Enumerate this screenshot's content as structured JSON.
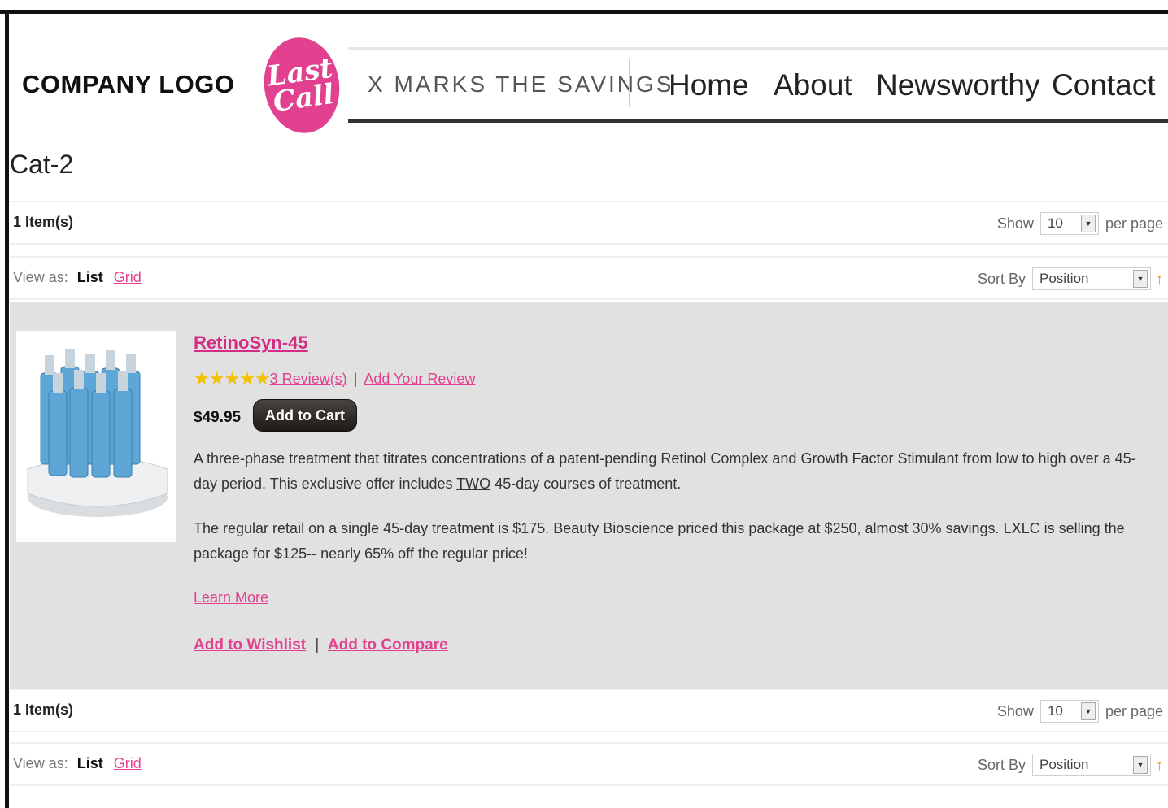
{
  "header": {
    "logo_text": "COMPANY LOGO",
    "badge_line1": "Last",
    "badge_line2": "Call",
    "tagline": "X MARKS THE SAVINGS",
    "nav": [
      "Home",
      "About",
      "Newsworthy",
      "Contact"
    ]
  },
  "page_title": "Cat-2",
  "toolbar": {
    "items_count": "1 Item(s)",
    "show_label": "Show",
    "show_value": "10",
    "per_page_label": "per page",
    "view_as_label": "View as:",
    "view_list": "List",
    "view_grid": "Grid",
    "sort_by_label": "Sort By",
    "sort_value": "Position",
    "sort_arrow": "↑"
  },
  "product": {
    "name": "RetinoSyn-45",
    "stars": "★★★★★",
    "rating_value": 5,
    "reviews_link": "3 Review(s)",
    "review_sep": "|",
    "add_review_link": "Add Your Review",
    "price": "$49.95",
    "add_to_cart": "Add to Cart",
    "desc1_before": "A three-phase treatment that titrates concentrations of a patent-pending Retinol Complex and Growth Factor Stimulant from low to high over a 45-day period. This exclusive offer includes ",
    "desc1_emph": "TWO",
    "desc1_after": " 45-day courses of treatment.",
    "desc2": "The regular retail on a single 45-day treatment is $175. Beauty Bioscience priced this package at $250, almost 30% savings. LXLC is selling the package for $125-- nearly 65% off the regular price!",
    "learn_more": "Learn More",
    "add_to_wishlist": "Add to Wishlist",
    "links_sep": "|",
    "add_to_compare": "Add to Compare"
  },
  "colors": {
    "accent_pink": "#e2418f",
    "product_bg": "#e2e1e2",
    "star": "#f2c200",
    "sort_arrow": "#f08a00"
  }
}
